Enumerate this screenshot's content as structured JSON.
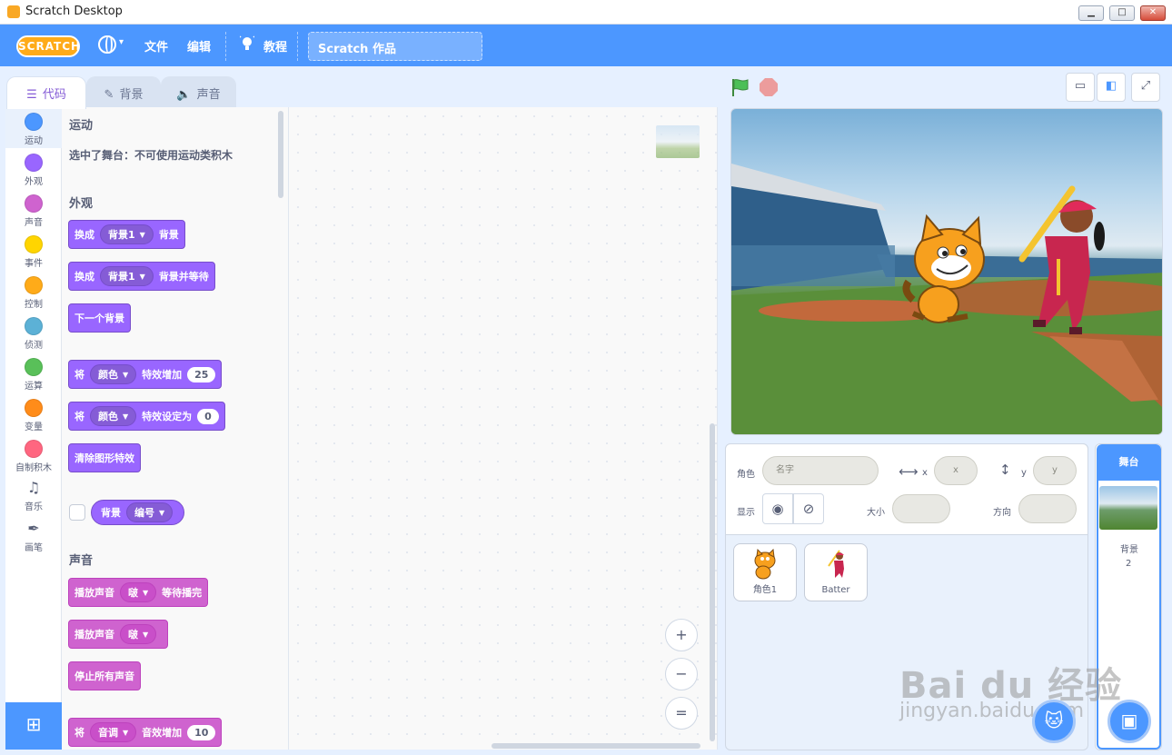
{
  "window": {
    "title": "Scratch Desktop"
  },
  "menubar": {
    "logo": "SCRATCH",
    "file": "文件",
    "edit": "编辑",
    "tutorials": "教程",
    "project_title": "Scratch 作品"
  },
  "tabs": [
    {
      "label": "代码",
      "icon": "code-icon",
      "active": true
    },
    {
      "label": "背景",
      "icon": "brush-icon",
      "active": false
    },
    {
      "label": "声音",
      "icon": "speaker-icon",
      "active": false
    }
  ],
  "categories": [
    {
      "label": "运动",
      "color": "#4c97ff",
      "selected": true
    },
    {
      "label": "外观",
      "color": "#9966ff"
    },
    {
      "label": "声音",
      "color": "#cf63cf"
    },
    {
      "label": "事件",
      "color": "#ffd500"
    },
    {
      "label": "控制",
      "color": "#ffab19"
    },
    {
      "label": "侦测",
      "color": "#5cb1d6"
    },
    {
      "label": "运算",
      "color": "#59c059"
    },
    {
      "label": "变量",
      "color": "#ff8c1a"
    },
    {
      "label": "自制积木",
      "color": "#ff6680"
    },
    {
      "label": "音乐",
      "icon": "music-icon"
    },
    {
      "label": "画笔",
      "icon": "pen-icon"
    }
  ],
  "palette": {
    "motion_title": "运动",
    "motion_note": "选中了舞台：不可使用运动类积木",
    "looks_title": "外观",
    "sound_title": "声音",
    "blocks": {
      "switch_backdrop": {
        "a": "换成",
        "drop": "背景1",
        "b": "背景"
      },
      "switch_backdrop_wait": {
        "a": "换成",
        "drop": "背景1",
        "b": "背景并等待"
      },
      "next_backdrop": {
        "a": "下一个背景"
      },
      "change_effect": {
        "a": "将",
        "drop": "颜色",
        "b": "特效增加",
        "num": "25"
      },
      "set_effect": {
        "a": "将",
        "drop": "颜色",
        "b": "特效设定为",
        "num": "0"
      },
      "clear_effects": {
        "a": "清除图形特效"
      },
      "backdrop_reporter": {
        "a": "背景",
        "drop": "编号"
      },
      "play_sound_until_done": {
        "a": "播放声音",
        "drop": "啵",
        "b": "等待播完"
      },
      "start_sound": {
        "a": "播放声音",
        "drop": "啵"
      },
      "stop_all_sounds": {
        "a": "停止所有声音"
      },
      "change_sound_effect": {
        "a": "将",
        "drop": "音调",
        "b": "音效增加",
        "num": "10"
      }
    }
  },
  "zoom": {
    "in": "+",
    "out": "−",
    "reset": "="
  },
  "sprite_info": {
    "sprite_label": "角色",
    "name_placeholder": "名字",
    "x_label": "x",
    "x_placeholder": "x",
    "y_label": "y",
    "y_placeholder": "y",
    "show_label": "显示",
    "size_label": "大小",
    "direction_label": "方向"
  },
  "sprites": [
    {
      "name": "角色1"
    },
    {
      "name": "Batter"
    }
  ],
  "stage_panel": {
    "title": "舞台",
    "backdrops_label": "背景",
    "backdrops_count": "2"
  },
  "watermark": {
    "big": "Bai du 经验",
    "small": "jingyan.baidu.com"
  },
  "colors": {
    "accent": "#4c97ff",
    "looks": "#9966ff",
    "sound": "#cf63cf"
  }
}
